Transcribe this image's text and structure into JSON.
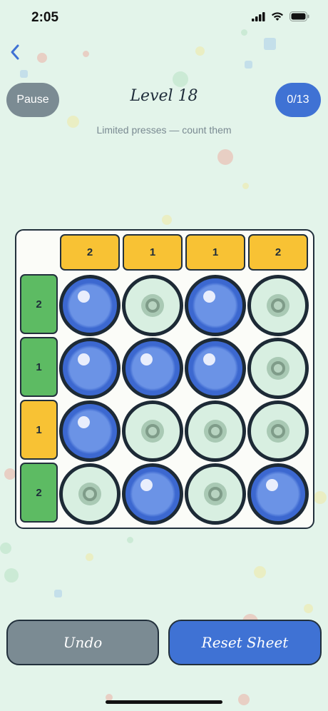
{
  "status_bar": {
    "time": "2:05"
  },
  "header": {
    "pause_label": "Pause",
    "title": "Level 18",
    "counter": "0/13",
    "subtitle": "Limited presses — count them"
  },
  "grid": {
    "column_targets": [
      "2",
      "1",
      "1",
      "2"
    ],
    "row_targets": [
      {
        "value": "2",
        "color": "green"
      },
      {
        "value": "1",
        "color": "green"
      },
      {
        "value": "1",
        "color": "yellow"
      },
      {
        "value": "2",
        "color": "green"
      }
    ],
    "cells": [
      [
        1,
        0,
        1,
        0
      ],
      [
        1,
        1,
        1,
        0
      ],
      [
        1,
        0,
        0,
        0
      ],
      [
        0,
        1,
        0,
        1
      ]
    ]
  },
  "actions": {
    "undo_label": "Undo",
    "reset_label": "Reset Sheet"
  },
  "colors": {
    "accent": "#3f72d4",
    "muted": "#7b8b93",
    "target_yellow": "#f8c234",
    "target_green": "#5dbb63",
    "background": "#e3f4ea"
  },
  "icons": [
    "wifi-icon",
    "battery-icon",
    "signal-icon",
    "back-chevron-icon"
  ]
}
